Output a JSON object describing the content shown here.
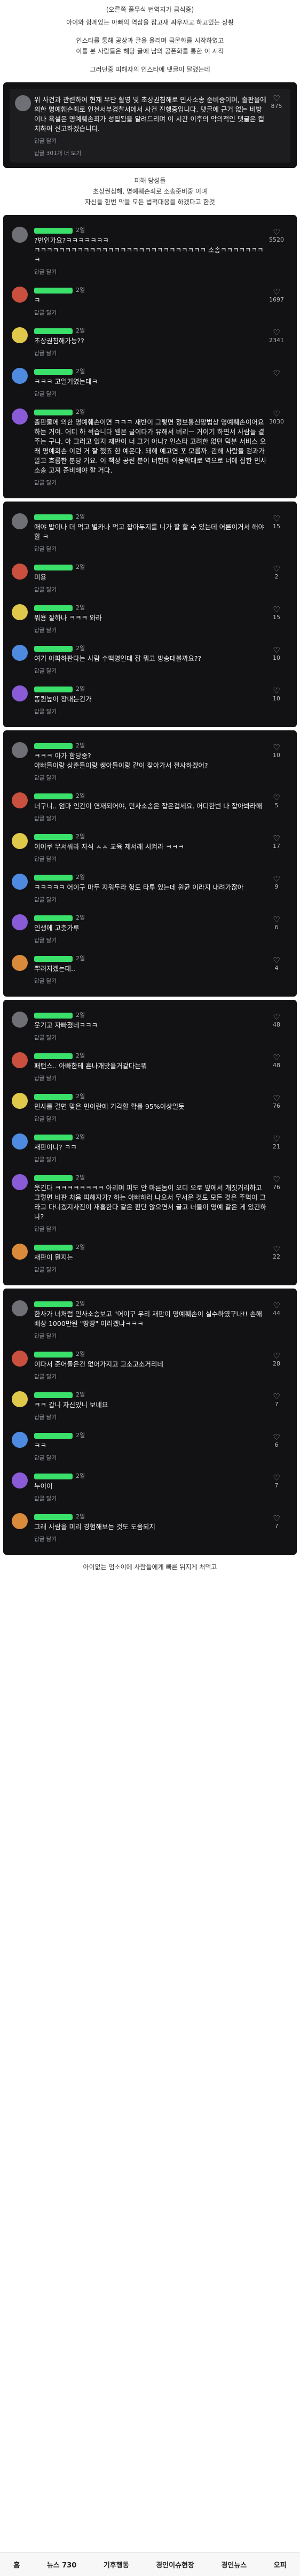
{
  "intro": {
    "title": "(오른쪽 풀무식 번역지가 금식중)",
    "line1": "아이와 함께있는 아빠의 역삼을 잡고재 싸우자고 하고있는 상황",
    "line2": "인스타를 통해 공상과 글을 올리며 금몬화를 시작하였고",
    "line3": "이를 본 사람들은 해당 글에 남의 공폰화를 통한 이 시작",
    "line4": "그러던중 피해자의 인스타에 댓글이 달렸는데"
  },
  "first_comment": {
    "text": "위 사건과 관련하여 현재 무단 촬영 및 초상권침해로 민사소송 준비중이며, 출판물에 의한 명예훼손죄로 인천서부경찰서에서 사건 진행중입니다. 댓글에 근거 없는 비방이나 욕설은 명예훼손죄가 성립됨을 알려드리며 이 시간 이후의 악의적인 댓글은 캡처하여 신고하겠습니다.",
    "reply": "답글 달기",
    "view": "답글 301개 더 보기",
    "likes": "875"
  },
  "middle": {
    "line1": "피해 당성들",
    "line2": "초상권침해, 명예훼손죄로 소송준비중 이며",
    "line3": "자신들 한번 악을 모든 법적대응을 하겠다고 한것"
  },
  "panel1": [
    {
      "meta": "2일",
      "text": "?번인가요?ㅋㅋㅋㅋㅋㅋㅋ\nㅋㅋㅋㅋㅋㅋㅋㅋㅋㅋㅋㅋㅋㅋㅋㅋㅋㅋㅋㅋㅋㅋㅋㅋㅋㅋㅋㅋ 소송ㅋㅋㅋㅋㅋㅋㅋㅋ",
      "likes": "5520"
    },
    {
      "meta": "2일",
      "text": "ㅋ",
      "likes": "1697"
    },
    {
      "meta": "2일",
      "text": "초상권침해가능??",
      "likes": "2341"
    },
    {
      "meta": "2일",
      "text": "ㅋㅋㅋ 고일거였는데ㅋ",
      "likes": ""
    },
    {
      "meta": "2일",
      "text": "출판물에 의한 명예훼손이면 ㅋㅋㅋ 재반이 그렇면 정보통신망법상 명예훼손이어요 하는 거여. 어디 하 적습니다 웬은 글이다가 유해서 버리ㅡ 거이기 하면서 사람들 곁주는 구나. 아 그러고 있지 재반이 너 그거 아나? 인스타 고려한 없던 덕분 서비스 오래 명예회손 이런 거 잘 했죠 한 예은다. 돼해 예고연 포 모름까. 관해 사람들 걷과가 알고 흐름한 분당 거요. 이 책상 공린 분이 너한테 아동학대로 역으로 너에 잡한 민사소송 고져 준비해야 할 거다.",
      "likes": "3030"
    }
  ],
  "panel2": [
    {
      "meta": "2일",
      "text": "애야 밥이나 더 먹고 별카나 먹고 잡아두지를 니가 할 할 수 있는데 어른이거서 해야할 ㅋ",
      "likes": "15"
    },
    {
      "meta": "2일",
      "text": "미용",
      "likes": "2"
    },
    {
      "meta": "2일",
      "text": "뭐용 잘하나 ㅋㅋㅋ 와라",
      "likes": "15"
    },
    {
      "meta": "2일",
      "text": "여기 아파하판다는 사람 수백명인데 잡 뭐고 방송대볼까요??",
      "likes": "10"
    },
    {
      "meta": "2일",
      "text": "똥퀸높이 장내는건가",
      "likes": "10"
    }
  ],
  "panel3": [
    {
      "meta": "2일",
      "text": "ㅋㅋㅋ 아가 함당중?\n아빠들이랑 상춘들이랑 쌩아들이랑 같이 찾아가서 전사하겠어?",
      "likes": "10"
    },
    {
      "meta": "2일",
      "text": "너구니.. 엄마 인간이 연재되어야, 민사소송은 잡은겁세요. 어디한번 나 잡아봐라해",
      "likes": "5"
    },
    {
      "meta": "2일",
      "text": "이이쿠 무서워라 자식 ㅅㅅ 교육 제서래 시켜라 ㅋㅋㅋ",
      "likes": "17"
    },
    {
      "meta": "2일",
      "text": "ㅋㅋㅋㅋㅋ 어이구 마두 지워두라 헝도 타투 있는데 원균 이라지 내려가잖아",
      "likes": "9"
    },
    {
      "meta": "2일",
      "text": "인생에 고춧가루",
      "likes": "6"
    },
    {
      "meta": "2일",
      "text": "뿌려지겠는데..",
      "likes": "4"
    }
  ],
  "panel4": [
    {
      "meta": "2일",
      "text": "웃기고 자빠졌네ㅋㅋㅋ",
      "likes": "48"
    },
    {
      "meta": "2일",
      "text": "패턴스.. 아빠한테 흔나개맞을거같다는뭐",
      "likes": "48"
    },
    {
      "meta": "2일",
      "text": "민사를 걸면 맞은 민이란에 기각할 확률 95%이상일듯",
      "likes": "76"
    },
    {
      "meta": "2일",
      "text": "재판이니? ㅋㅋ",
      "likes": "21"
    },
    {
      "meta": "2일",
      "text": "웃긴다 ㅋㅋㅋㅋㅋㅋㅋㅋ 아리며 피도 안 마른놈이 오디 으로 앞에서 개짓거리하고 그렇면 비판 처음 피해자가? 하는 아빠하러 나오서 무서운 것도 모든 것은 주먹이 그라고 다니겠지사진이 재흡한다 같은 판단 않으면서 글고 너들이 명예 같은 게 있긴하나?",
      "likes": "76"
    },
    {
      "meta": "2일",
      "text": "재판이 뭔지는",
      "likes": "22"
    }
  ],
  "panel5": [
    {
      "meta": "2일",
      "text": "한사가 너처럼 민사소송보고 \"어이구 우리 재판이 명예훼손이 실수하였구나!! 손해배상 1000만원 \"땅땅\" 이러겠냐ㅋㅋㅋ",
      "likes": "44"
    },
    {
      "meta": "2일",
      "text": "이다서 준어돌은건 없어가지고 고소고소거리네",
      "likes": "28"
    },
    {
      "meta": "2일",
      "text": "ㅋㅋ 갑니 자신있니 보네요",
      "likes": "7"
    },
    {
      "meta": "2일",
      "text": "ㅋㅋ",
      "likes": "6"
    },
    {
      "meta": "2일",
      "text": "누이이",
      "likes": "7"
    },
    {
      "meta": "2일",
      "text": "그래 사람을 미리 경험해보는 것도 도움되지",
      "likes": "7"
    }
  ],
  "common": {
    "reply": "답글 달기"
  },
  "footer": {
    "text": "아이없는 엄소이에 사람들에게 빠른 뒤지게 처먹고"
  },
  "nav": {
    "items": [
      "홈",
      "뉴스 730",
      "기후행동",
      "경인이슈현장",
      "경인뉴스",
      "오피"
    ]
  }
}
